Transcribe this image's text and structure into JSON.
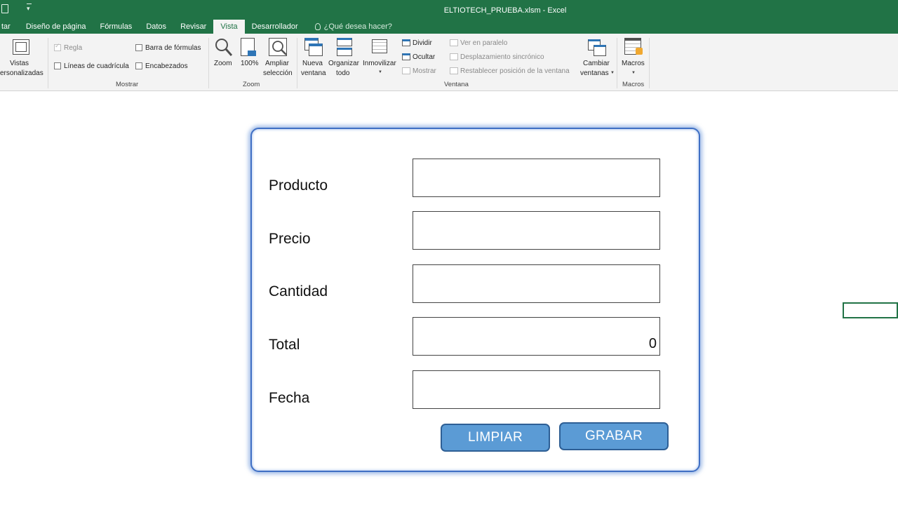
{
  "window": {
    "title": "ELTIOTECH_PRUEBA.xlsm - Excel"
  },
  "ribbon_tabs": [
    {
      "label": "tar"
    },
    {
      "label": "Diseño de página"
    },
    {
      "label": "Fórmulas"
    },
    {
      "label": "Datos"
    },
    {
      "label": "Revisar"
    },
    {
      "label": "Vista"
    },
    {
      "label": "Desarrollador"
    }
  ],
  "active_tab": "Vista",
  "tell_me": {
    "placeholder": "¿Qué desea hacer?"
  },
  "ribbon": {
    "views": {
      "label1": "Vistas",
      "label2": "ersonalizadas"
    },
    "mostrar": {
      "group_label": "Mostrar",
      "regla": "Regla",
      "lineas": "Líneas de cuadrícula",
      "barra": "Barra de fórmulas",
      "encabezados": "Encabezados"
    },
    "zoom": {
      "group_label": "Zoom",
      "zoom": "Zoom",
      "pct": "100%",
      "ampliar1": "Ampliar",
      "ampliar2": "selección"
    },
    "ventana": {
      "group_label": "Ventana",
      "nueva1": "Nueva",
      "nueva2": "ventana",
      "organizar1": "Organizar",
      "organizar2": "todo",
      "inmovilizar": "Inmovilizar",
      "dividir": "Dividir",
      "ocultar": "Ocultar",
      "mostrar": "Mostrar",
      "paralelo": "Ver en paralelo",
      "desplaz": "Desplazamiento sincrónico",
      "restablecer": "Restablecer posición de la ventana",
      "cambiar1": "Cambiar",
      "cambiar2": "ventanas"
    },
    "macros": {
      "group_label": "Macros",
      "macros": "Macros"
    }
  },
  "form": {
    "fields": [
      {
        "label": "Producto",
        "value": ""
      },
      {
        "label": "Precio",
        "value": ""
      },
      {
        "label": "Cantidad",
        "value": ""
      },
      {
        "label": "Total",
        "value": "0"
      },
      {
        "label": "Fecha",
        "value": ""
      }
    ],
    "buttons": {
      "limpiar": "LIMPIAR",
      "grabar": "GRABAR"
    }
  },
  "colors": {
    "excel_green": "#217346",
    "button_blue": "#5b9bd5",
    "form_border": "#3f6fc4"
  }
}
